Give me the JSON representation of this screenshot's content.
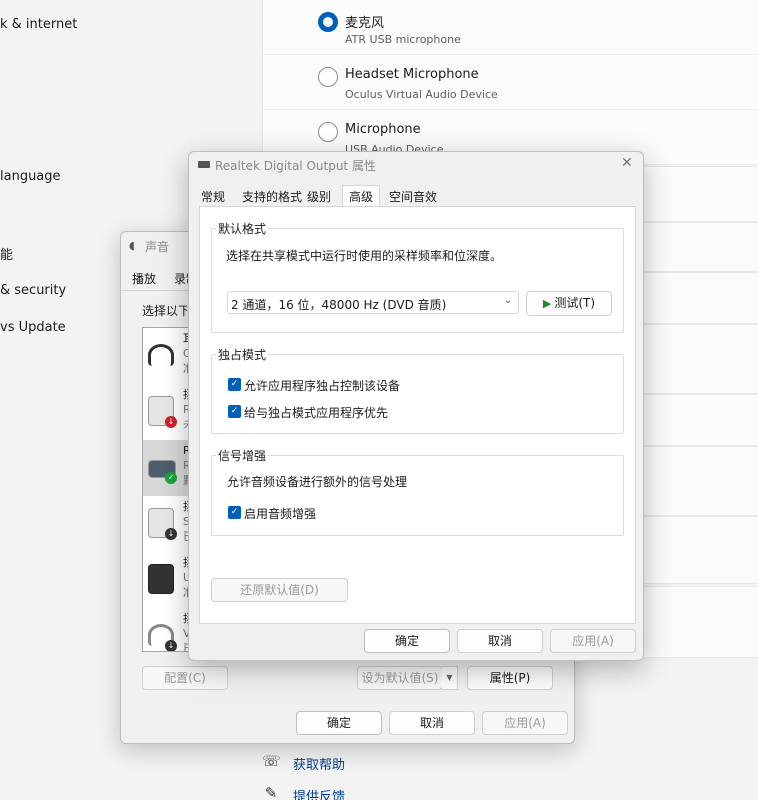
{
  "settings": {
    "nav_partial": [
      {
        "label": "k & internet"
      },
      {
        "label": " language"
      },
      {
        "label": "能"
      },
      {
        "label": "& security"
      },
      {
        "label": "vs Update"
      }
    ],
    "inputs": [
      {
        "title": "麦克风",
        "subtitle": "ATR USB microphone",
        "selected": true
      },
      {
        "title": "Headset Microphone",
        "subtitle": "Oculus Virtual Audio Device",
        "selected": false
      },
      {
        "title": "Microphone",
        "subtitle": "USB Audio Device",
        "selected": false
      }
    ],
    "help_links": [
      {
        "label": "获取帮助",
        "icon": "help-chat-icon"
      },
      {
        "label": "提供反馈",
        "icon": "feedback-icon"
      }
    ]
  },
  "sound_dialog": {
    "title": "声音",
    "tabs": [
      "播放",
      "录制"
    ],
    "prompt": "选择以下播放设备来修改设置:",
    "devices": [
      {
        "lines": [
          "耳",
          "C",
          "准"
        ],
        "icon": "headset-icon",
        "badge": ""
      },
      {
        "lines": [
          "扬",
          "R",
          "未"
        ],
        "icon": "speaker-icon",
        "badge": "red"
      },
      {
        "lines": [
          "R",
          "R",
          "默"
        ],
        "icon": "spdif-icon",
        "badge": "green"
      },
      {
        "lines": [
          "扬",
          "S",
          "已"
        ],
        "icon": "speaker-icon",
        "badge": "down"
      },
      {
        "lines": [
          "扬",
          "U",
          "准"
        ],
        "icon": "speaker-icon",
        "badge": ""
      },
      {
        "lines": [
          "扬",
          "V",
          "已"
        ],
        "icon": "headphones-icon",
        "badge": "down"
      }
    ],
    "buttons": {
      "configure": "配置(C)",
      "set_default": "设为默认值(S)",
      "properties": "属性(P)",
      "ok": "确定",
      "cancel": "取消",
      "apply": "应用(A)"
    }
  },
  "properties_dialog": {
    "title": "Realtek Digital Output 属性",
    "tabs": [
      "常规",
      "支持的格式",
      "级别",
      "高级",
      "空间音效"
    ],
    "active_tab": "高级",
    "default_format": {
      "heading": "默认格式",
      "description": "选择在共享模式中运行时使用的采样频率和位深度。",
      "selected": "2 通道，16 位，48000 Hz (DVD 音质)",
      "test_label": "测试(T)"
    },
    "exclusive_mode": {
      "heading": "独占模式",
      "options": [
        {
          "label": "允许应用程序独占控制该设备",
          "checked": true
        },
        {
          "label": "给与独占模式应用程序优先",
          "checked": true
        }
      ]
    },
    "signal_enhancement": {
      "heading": "信号增强",
      "description": "允许音频设备进行额外的信号处理",
      "options": [
        {
          "label": "启用音频增强",
          "checked": true
        }
      ]
    },
    "buttons": {
      "restore_defaults": "还原默认值(D)",
      "ok": "确定",
      "cancel": "取消",
      "apply": "应用(A)"
    }
  }
}
